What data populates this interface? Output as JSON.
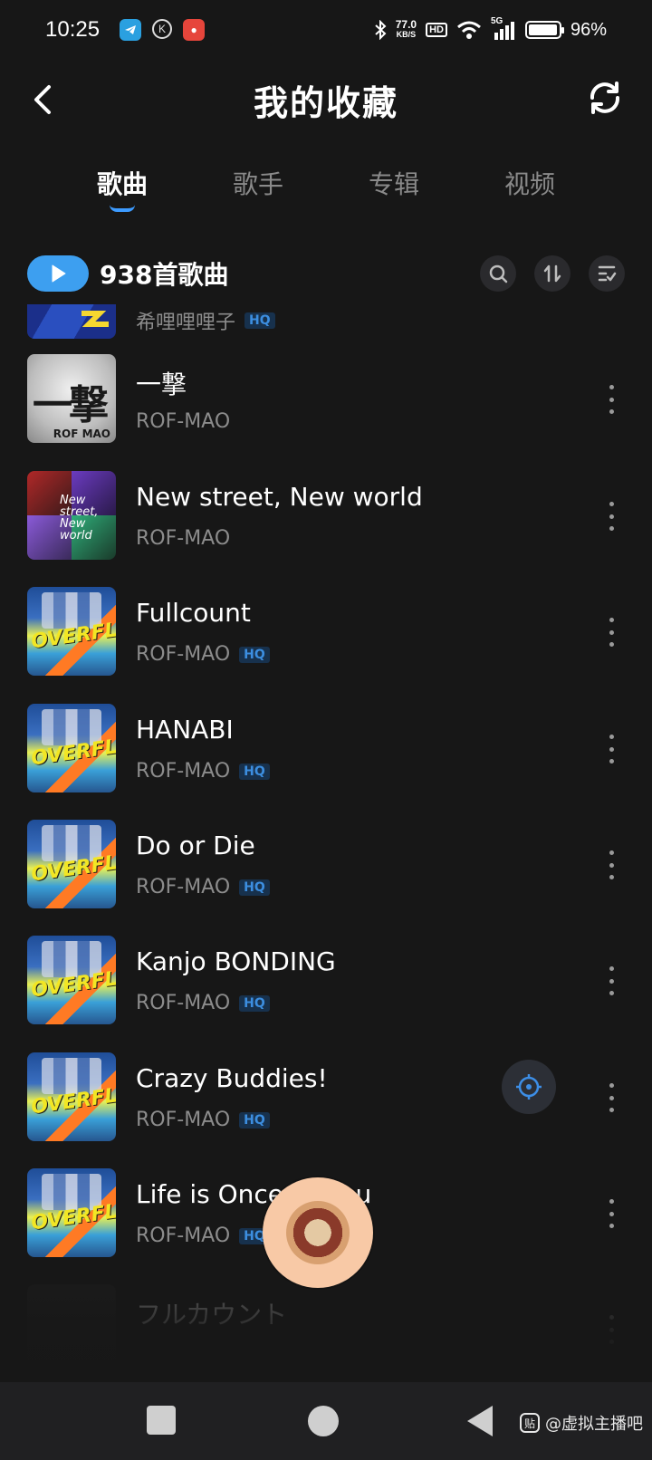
{
  "status_bar": {
    "time": "10:25",
    "net_speed_value": "77.0",
    "net_speed_unit": "KB/S",
    "hd": "HD",
    "network": "5G",
    "battery": "96%",
    "battery_level": 0.96,
    "app_icons": [
      "telegram-icon",
      "k-icon",
      "red-app-icon"
    ]
  },
  "header": {
    "title": "我的收藏"
  },
  "tabs": [
    {
      "label": "歌曲",
      "active": true
    },
    {
      "label": "歌手",
      "active": false
    },
    {
      "label": "专辑",
      "active": false
    },
    {
      "label": "视频",
      "active": false
    }
  ],
  "toolbar": {
    "song_count": "938首歌曲",
    "icons": [
      "search-icon",
      "sort-icon",
      "multi-select-icon"
    ]
  },
  "songs": [
    {
      "title": "",
      "artist": "希哩哩哩子",
      "hq": "HQ"
    },
    {
      "title": "一撃",
      "artist": "ROF-MAO",
      "hq": ""
    },
    {
      "title": "New street, New world",
      "artist": "ROF-MAO",
      "hq": ""
    },
    {
      "title": "Fullcount",
      "artist": "ROF-MAO",
      "hq": "HQ"
    },
    {
      "title": "HANABI",
      "artist": "ROF-MAO",
      "hq": "HQ"
    },
    {
      "title": "Do or Die",
      "artist": "ROF-MAO",
      "hq": "HQ"
    },
    {
      "title": "Kanjo BONDING",
      "artist": "ROF-MAO",
      "hq": "HQ"
    },
    {
      "title": "Crazy Buddies!",
      "artist": "ROF-MAO",
      "hq": "HQ"
    },
    {
      "title": "Life is Once d... ou",
      "artist": "ROF-MAO",
      "hq": "HQ"
    },
    {
      "title": "フルカウント",
      "artist": "",
      "hq": ""
    }
  ],
  "covers": {
    "ichigeki_text": "一撃",
    "ichigeki_sub": "ROF MAO",
    "newstreet_text": "New street, New world",
    "overflow_text": "OVERFLOW"
  },
  "watermark": {
    "logo": "贴",
    "text": "@虚拟主播吧"
  }
}
